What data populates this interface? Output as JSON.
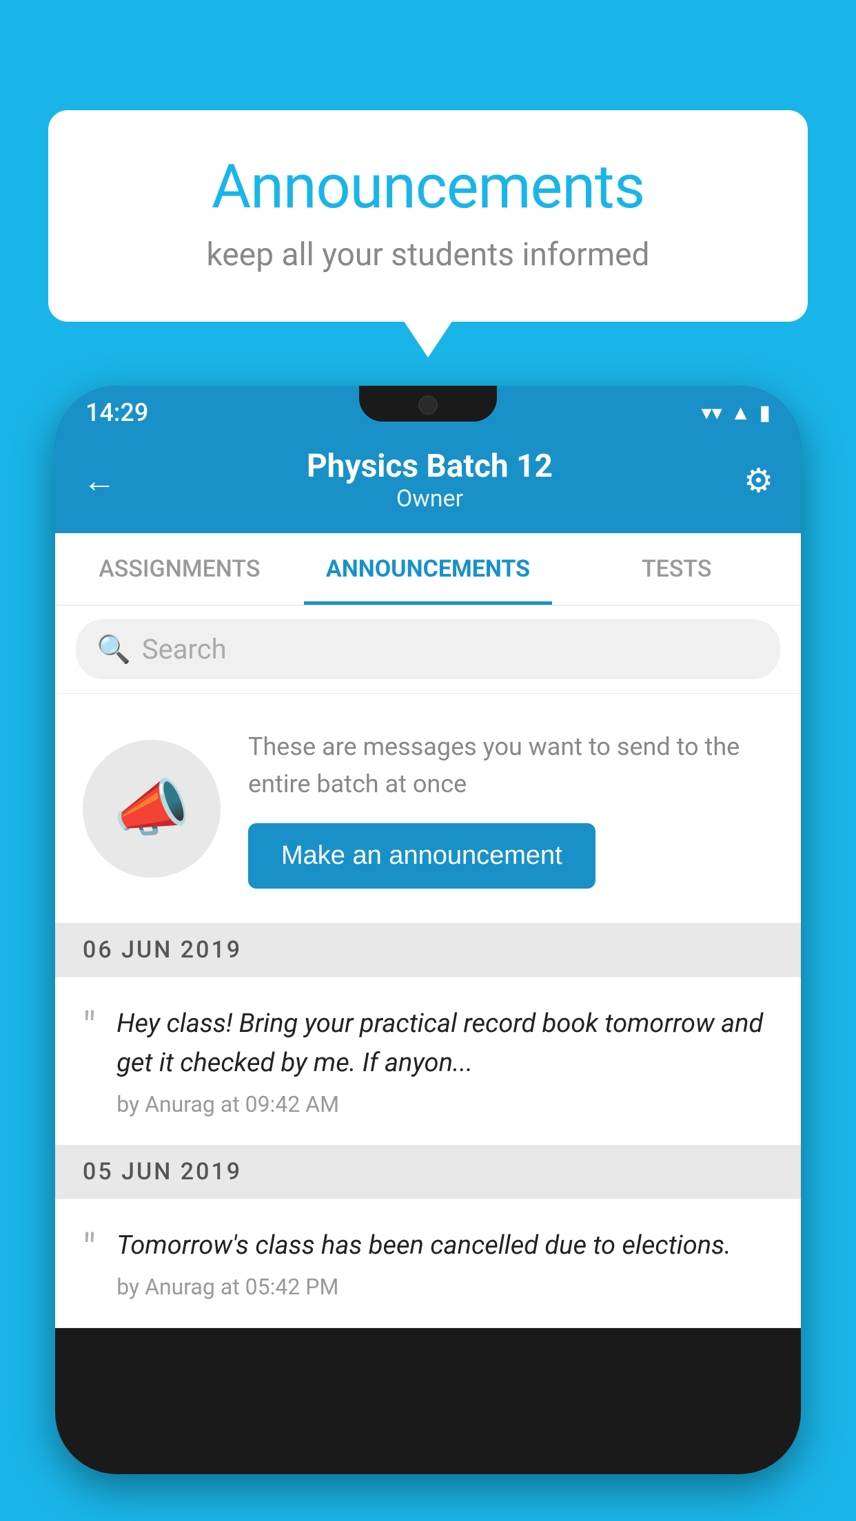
{
  "background_color": "#1ab5e8",
  "speech_bubble": {
    "title": "Announcements",
    "subtitle": "keep all your students informed"
  },
  "phone": {
    "status_bar": {
      "time": "14:29",
      "wifi_icon": "▼",
      "signal_icon": "▲",
      "battery_icon": "▬"
    },
    "header": {
      "title": "Physics Batch 12",
      "subtitle": "Owner",
      "back_label": "←",
      "settings_label": "⚙"
    },
    "tabs": [
      {
        "label": "ASSIGNMENTS",
        "active": false
      },
      {
        "label": "ANNOUNCEMENTS",
        "active": true
      },
      {
        "label": "TESTS",
        "active": false
      },
      {
        "label": "...",
        "active": false
      }
    ],
    "search": {
      "placeholder": "Search"
    },
    "announcement_prompt": {
      "text": "These are messages you want to send to the entire batch at once",
      "button_label": "Make an announcement"
    },
    "messages": [
      {
        "date": "06  JUN  2019",
        "text": "Hey class! Bring your practical record book tomorrow and get it checked by me. If anyon...",
        "meta": "by Anurag at 09:42 AM"
      },
      {
        "date": "05  JUN  2019",
        "text": "Tomorrow's class has been cancelled due to elections.",
        "meta": "by Anurag at 05:42 PM"
      }
    ]
  }
}
